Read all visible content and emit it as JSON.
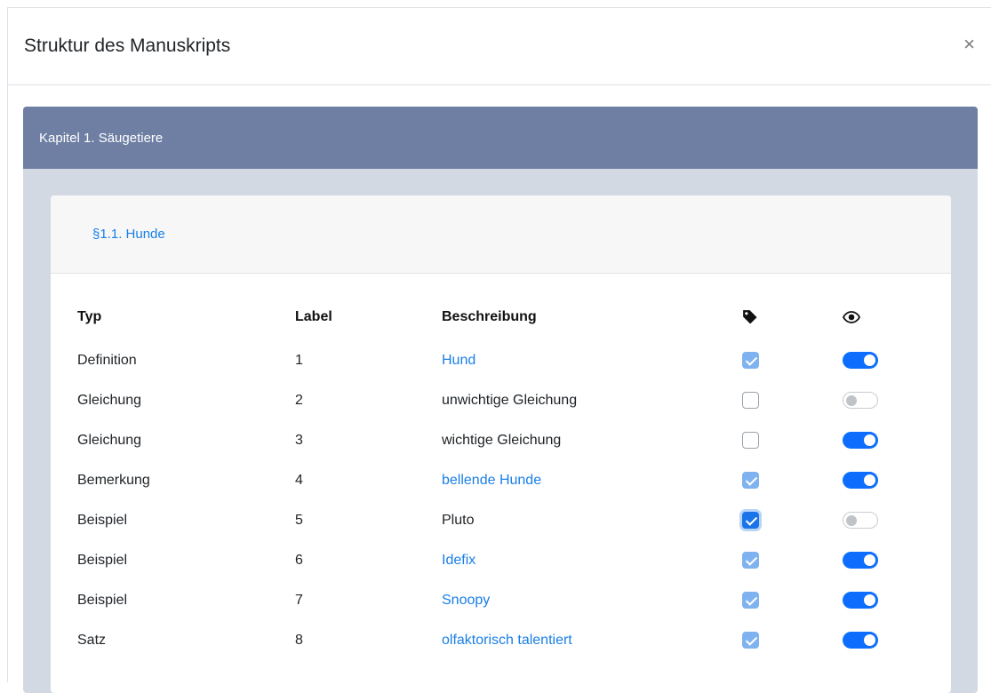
{
  "modal": {
    "title": "Struktur des Manuskripts",
    "close_label": "×"
  },
  "chapter": {
    "title": "Kapitel 1. Säugetiere"
  },
  "section": {
    "title": "§1.1. Hunde"
  },
  "table": {
    "headers": {
      "typ": "Typ",
      "label": "Label",
      "beschreibung": "Beschreibung",
      "tag_icon": "tag-icon",
      "visibility_icon": "eye-icon"
    },
    "rows": [
      {
        "typ": "Definition",
        "label": "1",
        "beschreibung": "Hund",
        "is_link": true,
        "tagged": true,
        "visible": true
      },
      {
        "typ": "Gleichung",
        "label": "2",
        "beschreibung": "unwichtige Gleichung",
        "is_link": false,
        "tagged": false,
        "visible": false
      },
      {
        "typ": "Gleichung",
        "label": "3",
        "beschreibung": "wichtige Gleichung",
        "is_link": false,
        "tagged": false,
        "visible": true
      },
      {
        "typ": "Bemerkung",
        "label": "4",
        "beschreibung": "bellende Hunde",
        "is_link": true,
        "tagged": true,
        "visible": true
      },
      {
        "typ": "Beispiel",
        "label": "5",
        "beschreibung": "Pluto",
        "is_link": false,
        "tagged": true,
        "visible": false,
        "focused": true
      },
      {
        "typ": "Beispiel",
        "label": "6",
        "beschreibung": "Idefix",
        "is_link": true,
        "tagged": true,
        "visible": true
      },
      {
        "typ": "Beispiel",
        "label": "7",
        "beschreibung": "Snoopy",
        "is_link": true,
        "tagged": true,
        "visible": true
      },
      {
        "typ": "Satz",
        "label": "8",
        "beschreibung": "olfaktorisch talentiert",
        "is_link": true,
        "tagged": true,
        "visible": true
      }
    ]
  },
  "colors": {
    "chapter_header_bg": "#6e7fa3",
    "chapter_body_bg": "#d3d9e3",
    "link": "#1a7fe6",
    "switch_on": "#0d6efd"
  }
}
